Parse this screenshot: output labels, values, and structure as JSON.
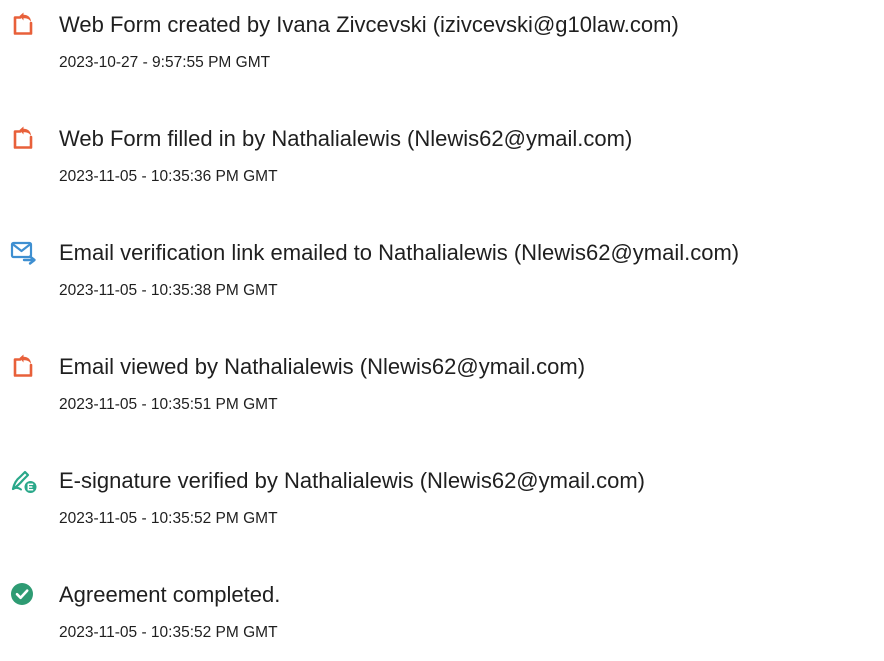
{
  "colors": {
    "pdf_icon": "#e8603a",
    "email_icon": "#3e8fd1",
    "signature_icon": "#2aa88a",
    "check_icon": "#2e9b73",
    "text": "#1f1f1f"
  },
  "events": [
    {
      "icon": "document-icon",
      "title": "Web Form created by Ivana Zivcevski (izivcevski@g10law.com)",
      "time": "2023-10-27 - 9:57:55 PM GMT"
    },
    {
      "icon": "document-icon",
      "title": "Web Form filled in by Nathalialewis (Nlewis62@ymail.com)",
      "time": "2023-11-05 - 10:35:36 PM GMT"
    },
    {
      "icon": "email-send-icon",
      "title": "Email verification link emailed to Nathalialewis (Nlewis62@ymail.com)",
      "time": "2023-11-05 - 10:35:38 PM GMT"
    },
    {
      "icon": "document-icon",
      "title": "Email viewed by Nathalialewis (Nlewis62@ymail.com)",
      "time": "2023-11-05 - 10:35:51 PM GMT"
    },
    {
      "icon": "signature-verified-icon",
      "title": "E-signature verified by Nathalialewis (Nlewis62@ymail.com)",
      "time": "2023-11-05 - 10:35:52 PM GMT"
    },
    {
      "icon": "check-circle-icon",
      "title": "Agreement completed.",
      "time": "2023-11-05 - 10:35:52 PM GMT"
    }
  ]
}
